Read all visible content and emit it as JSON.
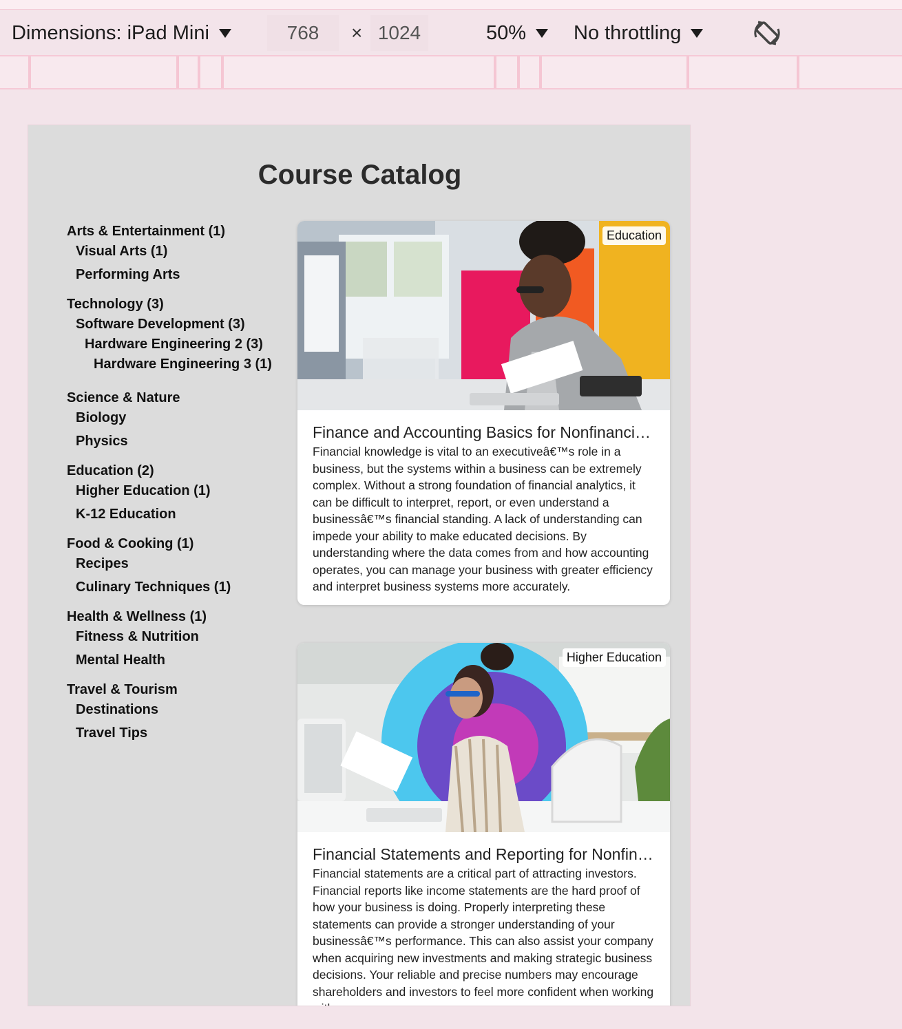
{
  "devtools": {
    "dimensions_label": "Dimensions: iPad Mini",
    "width": "768",
    "times": "×",
    "height": "1024",
    "zoom": "50%",
    "throttling": "No throttling"
  },
  "page": {
    "title": "Course Catalog"
  },
  "sidebar": {
    "groups": [
      {
        "items": [
          "Arts & Entertainment (1)",
          "Visual Arts (1)",
          "Performing Arts"
        ]
      },
      {
        "items": [
          "Technology (3)",
          "Software Development (3)",
          "Hardware Engineering 2 (3)",
          "Hardware Engineering 3 (1)"
        ]
      },
      {
        "items": [
          "Science & Nature",
          "Biology",
          "Physics"
        ]
      },
      {
        "items": [
          "Education (2)",
          "Higher Education (1)",
          "K-12 Education"
        ]
      },
      {
        "items": [
          "Food & Cooking (1)",
          "Recipes",
          "Culinary Techniques (1)"
        ]
      },
      {
        "items": [
          "Health & Wellness (1)",
          "Fitness & Nutrition",
          "Mental Health"
        ]
      },
      {
        "items": [
          "Travel & Tourism",
          "Destinations",
          "Travel Tips"
        ]
      }
    ]
  },
  "courses": [
    {
      "badge": "Education",
      "title": "Finance and Accounting Basics for Nonfinancia...",
      "description": "Financial knowledge is vital to an executiveâ€™s role in a business, but the systems within a business can be extremely complex. Without a strong foundation of financial analytics, it can be difficult to interpret, report, or even understand a businessâ€™s financial standing. A lack of understanding can impede your ability to make educated decisions. By understanding where the data comes from and how accounting operates, you can manage your business with greater efficiency and interpret business systems more accurately."
    },
    {
      "badge": "Higher Education",
      "title": "Financial Statements and Reporting for Nonfina...",
      "description": "Financial statements are a critical part of attracting investors. Financial reports like income statements are the hard proof of how your business is doing. Properly interpreting these statements can provide a stronger understanding of your businessâ€™s performance. This can also assist your company when acquiring new investments and making strategic business decisions. Your reliable and precise numbers may encourage shareholders and investors to feel more confident when working with you."
    }
  ],
  "colors": {
    "page_background": "#dcdcdc",
    "devtools_background": "#f3e4ea",
    "accent_pink": "#f5c6d3"
  }
}
